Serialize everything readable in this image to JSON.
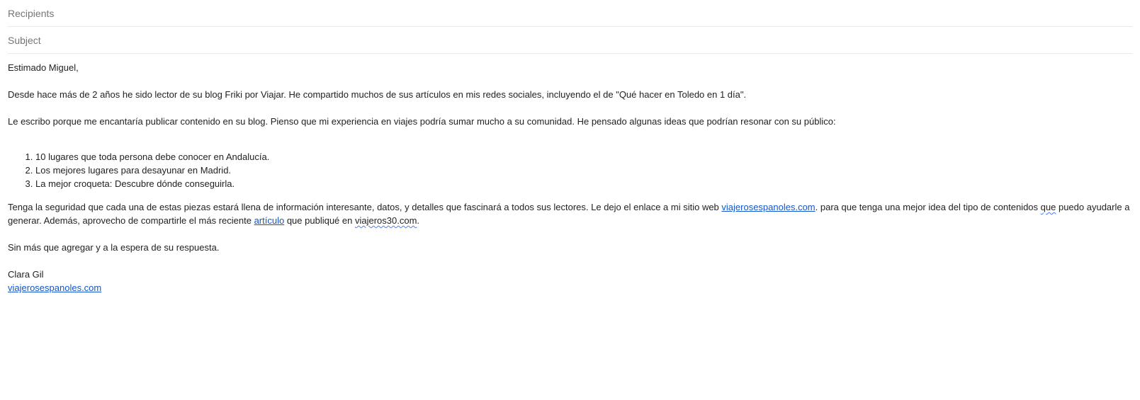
{
  "compose": {
    "recipients_placeholder": "Recipients",
    "subject_placeholder": "Subject"
  },
  "body": {
    "greeting": "Estimado Miguel,",
    "paragraph1": "Desde hace más de 2 años he sido lector de su blog Friki por Viajar. He compartido muchos de sus artículos en mis redes sociales, incluyendo el de \"Qué hacer en Toledo en 1 día\".",
    "paragraph2": "Le escribo porque me encantaría publicar contenido en su blog. Pienso que mi experiencia en viajes podría sumar mucho a su comunidad. He pensado algunas ideas que podrían resonar con su público:",
    "ideas": [
      "10 lugares que toda persona debe conocer en Andalucía.",
      "Los mejores lugares para desayunar en Madrid.",
      "La mejor croqueta: Descubre dónde conseguirla."
    ],
    "p3_part1": "Tenga la seguridad que cada una de estas piezas estará llena de información interesante, datos, y detalles que fascinará a todos sus lectores. Le dejo el enlace a mi sitio web ",
    "p3_link1": "viajerosespanoles.com",
    "p3_part2": ". para que tenga una mejor idea del tipo de contenidos ",
    "p3_que": "que",
    "p3_part3": " puedo ayudarle a generar. Además, aprovecho de compartirle el más reciente ",
    "p3_link2": "artículo",
    "p3_part4": " que publiqué en ",
    "p3_site": "viajeros30.com",
    "p3_part5": ".",
    "closing": "Sin más que agregar y a la espera de su respuesta.",
    "signature_name": "Clara Gil",
    "signature_link": "viajerosespanoles.com"
  },
  "colors": {
    "link": "#1155cc",
    "placeholder": "#757575",
    "divider": "#e8eaed",
    "spellcheck": "#4d7cff"
  }
}
